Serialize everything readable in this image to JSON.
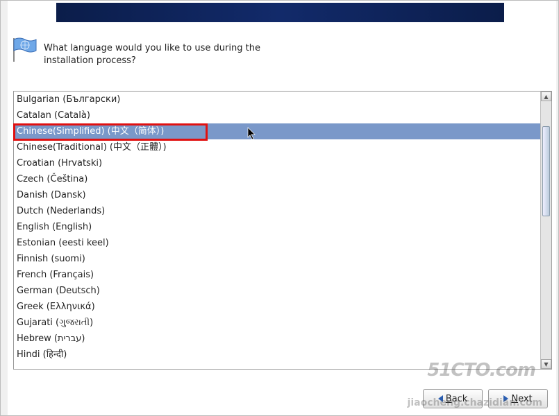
{
  "prompt": "What language would you like to use during the installation process?",
  "languages": [
    {
      "label": "Bulgarian (Български)",
      "selected": false
    },
    {
      "label": "Catalan (Català)",
      "selected": false
    },
    {
      "label": "Chinese(Simplified) (中文（简体）)",
      "selected": true
    },
    {
      "label": "Chinese(Traditional) (中文（正體）)",
      "selected": false
    },
    {
      "label": "Croatian (Hrvatski)",
      "selected": false
    },
    {
      "label": "Czech (Čeština)",
      "selected": false
    },
    {
      "label": "Danish (Dansk)",
      "selected": false
    },
    {
      "label": "Dutch (Nederlands)",
      "selected": false
    },
    {
      "label": "English (English)",
      "selected": false
    },
    {
      "label": "Estonian (eesti keel)",
      "selected": false
    },
    {
      "label": "Finnish (suomi)",
      "selected": false
    },
    {
      "label": "French (Français)",
      "selected": false
    },
    {
      "label": "German (Deutsch)",
      "selected": false
    },
    {
      "label": "Greek (Ελληνικά)",
      "selected": false
    },
    {
      "label": "Gujarati (ગુજરાતી)",
      "selected": false
    },
    {
      "label": "Hebrew (עברית)",
      "selected": false
    },
    {
      "label": "Hindi (हिन्दी)",
      "selected": false
    }
  ],
  "buttons": {
    "back": "Back",
    "next": "Next"
  },
  "watermark1": "51CTO.com",
  "watermark2": "jiaocheng.chazidian.com",
  "icons": {
    "flag": "flag-icon",
    "back_arrow": "arrow-left-icon",
    "next_arrow": "arrow-right-icon"
  }
}
